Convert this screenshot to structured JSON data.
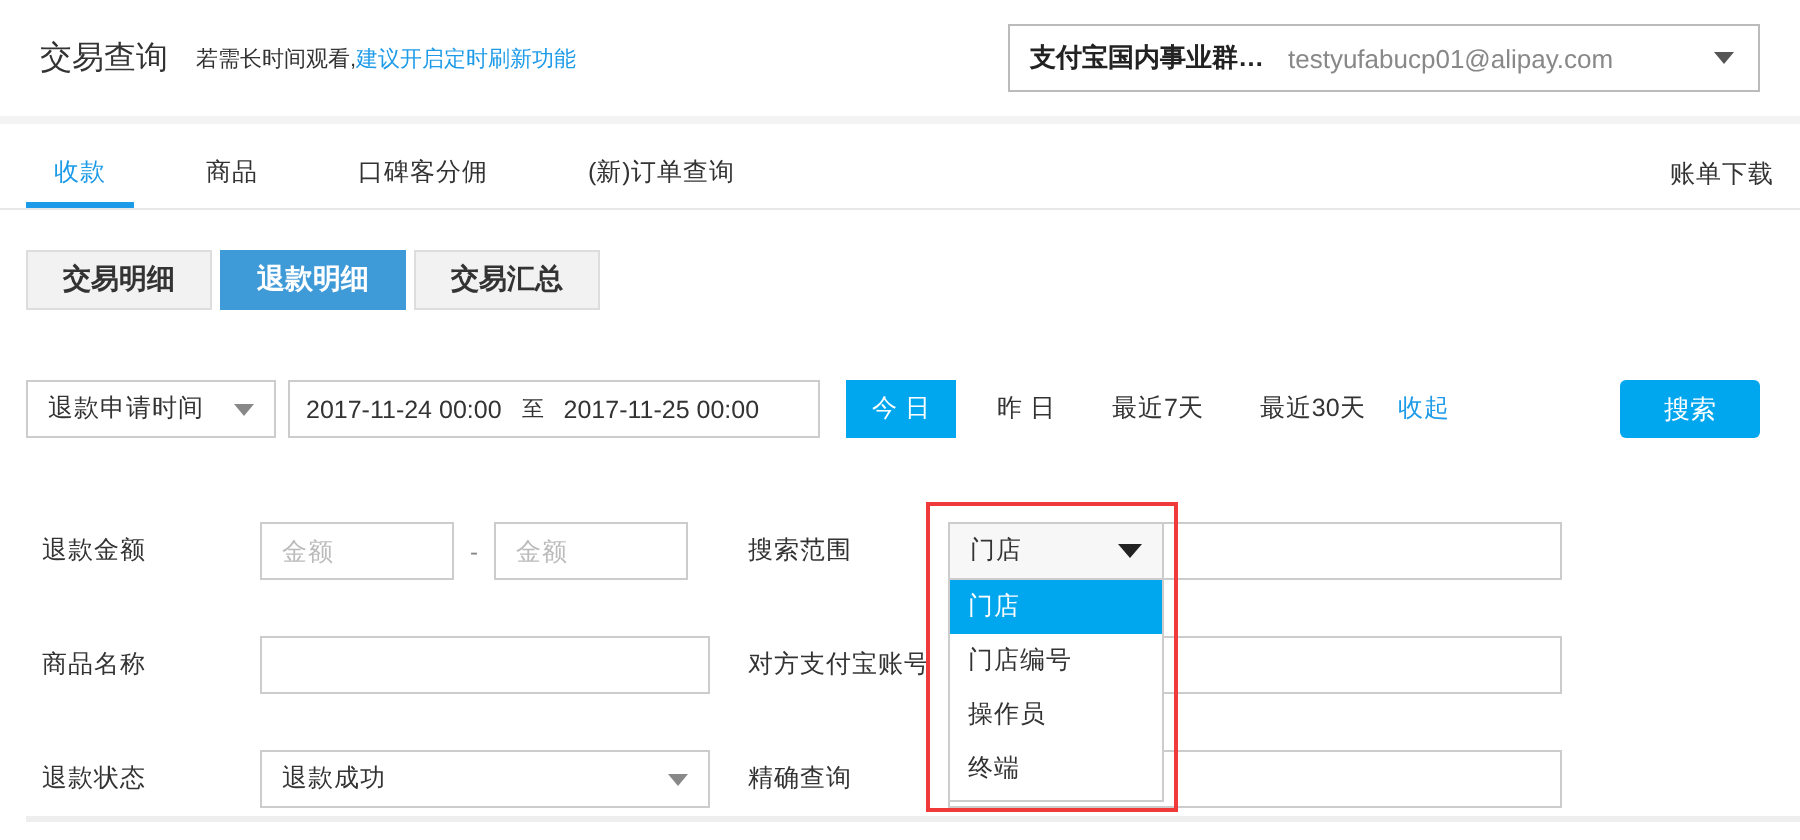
{
  "header": {
    "title": "交易查询",
    "notice": "若需长时间观看,",
    "notice_link": "建议开启定时刷新功能",
    "account": {
      "name": "支付宝国内事业群…",
      "email": "testyufabucp01@alipay.com"
    }
  },
  "tabs": [
    {
      "label": "收款",
      "selected": true
    },
    {
      "label": "商品",
      "selected": false
    },
    {
      "label": "口碑客分佣",
      "selected": false
    },
    {
      "label": "(新)订单查询",
      "selected": false
    }
  ],
  "download_link": "账单下载",
  "view_buttons": [
    {
      "label": "交易明细",
      "selected": false
    },
    {
      "label": "退款明细",
      "selected": true
    },
    {
      "label": "交易汇总",
      "selected": false
    }
  ],
  "date_filter": {
    "time_type": "退款申请时间",
    "start": "2017-11-24 00:00",
    "separator": "至",
    "end": "2017-11-25 00:00"
  },
  "quick_ranges": [
    {
      "label": "今 日",
      "selected": true
    },
    {
      "label": "昨 日",
      "selected": false
    },
    {
      "label": "最近7天",
      "selected": false
    },
    {
      "label": "最近30天",
      "selected": false
    }
  ],
  "collapse_link": "收起",
  "search_button": "搜索",
  "form": {
    "amount": {
      "label": "退款金额",
      "min_placeholder": "金额",
      "separator": "-",
      "max_placeholder": "金额"
    },
    "product_name": {
      "label": "商品名称"
    },
    "refund_status": {
      "label": "退款状态",
      "value": "退款成功"
    },
    "scope": {
      "label": "搜索范围",
      "value": "门店",
      "expanded": true,
      "highlighted": true,
      "options": [
        {
          "label": "门店",
          "selected": true
        },
        {
          "label": "门店编号",
          "selected": false
        },
        {
          "label": "操作员",
          "selected": false
        },
        {
          "label": "终端",
          "selected": false
        }
      ]
    },
    "counterparty": {
      "label": "对方支付宝账号"
    },
    "exact": {
      "label": "精确查询"
    }
  }
}
